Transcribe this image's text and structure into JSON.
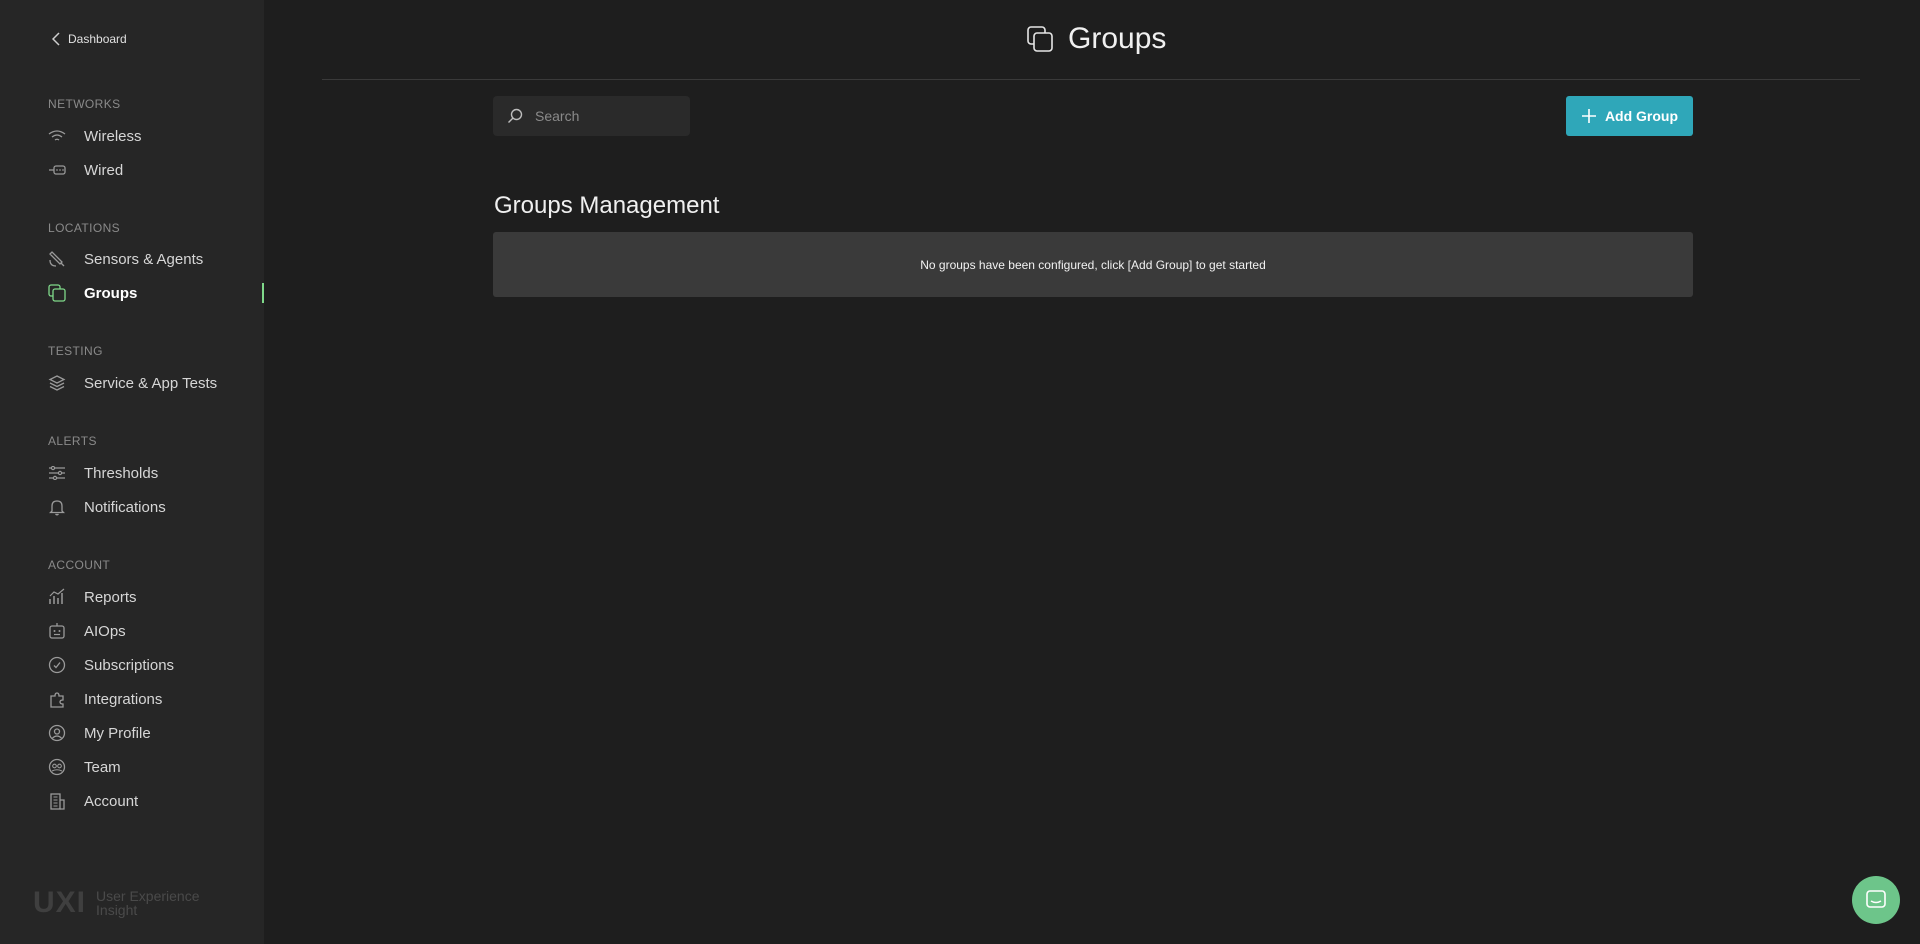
{
  "sidebar": {
    "back_label": "Dashboard",
    "sections": {
      "networks": "NETWORKS",
      "locations": "LOCATIONS",
      "testing": "TESTING",
      "alerts": "ALERTS",
      "account": "ACCOUNT"
    },
    "items": {
      "wireless": "Wireless",
      "wired": "Wired",
      "sensors": "Sensors & Agents",
      "groups": "Groups",
      "service_tests": "Service & App Tests",
      "thresholds": "Thresholds",
      "notifications": "Notifications",
      "reports": "Reports",
      "aiops": "AIOps",
      "subscriptions": "Subscriptions",
      "integrations": "Integrations",
      "my_profile": "My Profile",
      "team": "Team",
      "account": "Account"
    },
    "active_item": "groups",
    "brand": {
      "mark": "UXI",
      "line1": "User Experience",
      "line2": "Insight"
    }
  },
  "header": {
    "title": "Groups"
  },
  "toolbar": {
    "search_placeholder": "Search",
    "search_value": "",
    "add_label": "Add Group"
  },
  "main": {
    "section_title": "Groups Management",
    "empty_message": "No groups have been configured, click [Add Group] to get started"
  },
  "colors": {
    "accent_button": "#2fa7b9",
    "active_indicator": "#7fd98a",
    "chat_fab": "#6dc58a"
  }
}
